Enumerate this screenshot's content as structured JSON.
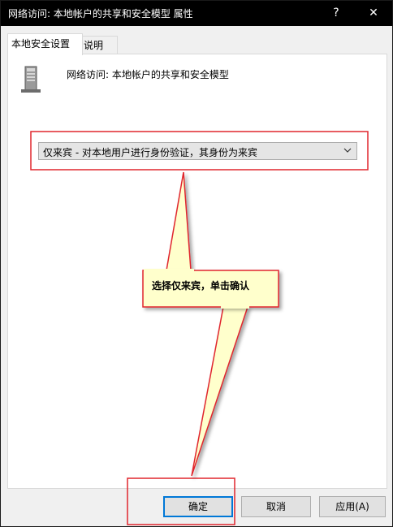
{
  "window": {
    "title": "网络访问: 本地帐户的共享和安全模型 属性",
    "help_label": "?",
    "close_label": "✕"
  },
  "tabs": [
    {
      "label": "本地安全设置",
      "active": true
    },
    {
      "label": "说明",
      "active": false
    }
  ],
  "policy": {
    "icon": "server-icon",
    "title": "网络访问: 本地帐户的共享和安全模型",
    "selected_option": "仅来宾 - 对本地用户进行身份验证，其身份为来宾"
  },
  "annotation": {
    "callout_text": "选择仅来宾，单击确认",
    "highlight_color": "#e0262d",
    "callout_fill": "#ffffcc"
  },
  "buttons": {
    "ok": "确定",
    "cancel": "取消",
    "apply": "应用(A)"
  }
}
